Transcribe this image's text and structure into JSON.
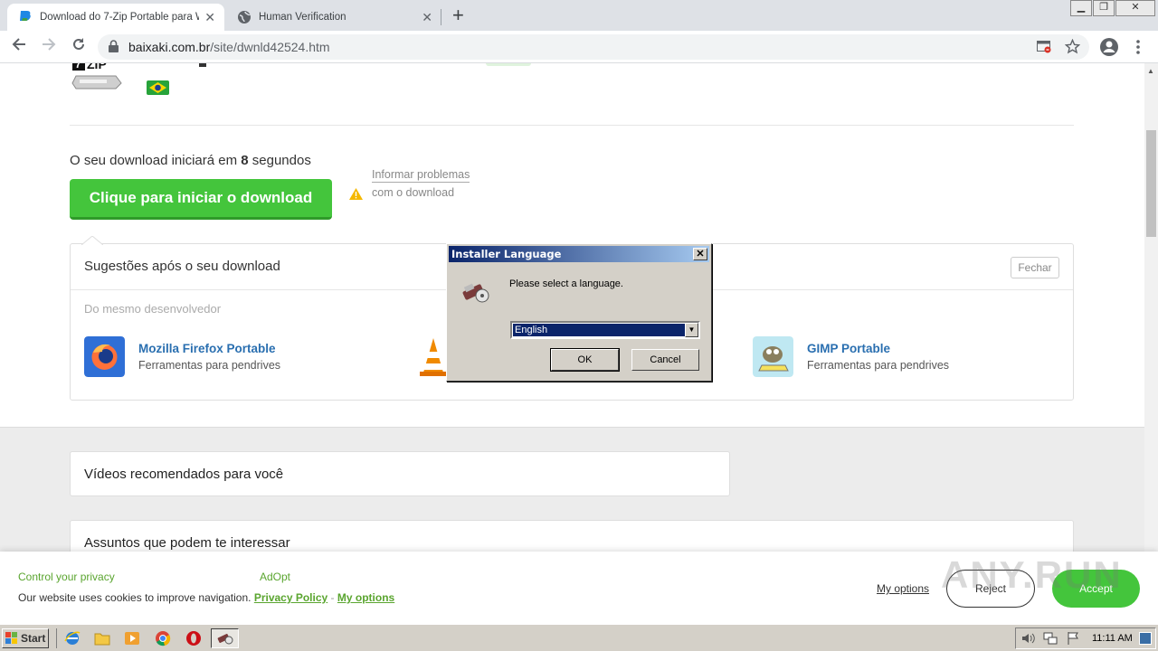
{
  "browser": {
    "tabs": [
      {
        "title": "Download do 7-Zip Portable para Windows",
        "active": true
      },
      {
        "title": "Human Verification",
        "active": false
      }
    ],
    "close_glyph": "✕",
    "new_tab_glyph": "+",
    "url_host": "baixaki.com.br",
    "url_path": "/site/dwnld42524.htm",
    "icons": [
      "back-icon",
      "forward-icon",
      "reload-icon",
      "lock-icon",
      "popup-blocked-icon",
      "bookmark-star-icon",
      "account-icon",
      "menu-icon"
    ]
  },
  "page": {
    "countdown_prefix": "O seu download iniciará em ",
    "countdown_seconds": "8",
    "countdown_suffix": " segundos",
    "download_button": "Clique para iniciar o download",
    "report_line1": "Informar problemas",
    "report_line2": "com o download",
    "suggestions": {
      "title": "Sugestões após o seu download",
      "close_button": "Fechar",
      "section_label": "Do mesmo desenvolvedor",
      "apps": [
        {
          "name": "Mozilla Firefox Portable",
          "category": "Ferramentas para pendrives"
        },
        {
          "name": "GIMP Portable",
          "category": "Ferramentas para pendrives"
        }
      ]
    },
    "videos_title": "Vídeos recomendados para você",
    "topics_title": "Assuntos que podem te interessar"
  },
  "cookie_bar": {
    "heading": "Control your privacy",
    "brand": "AdOpt",
    "message": "Our website uses cookies to improve navigation.",
    "privacy_link": "Privacy Policy",
    "separator": "-",
    "options_link": "My options",
    "my_options_button": "My options",
    "reject_button": "Reject",
    "accept_button": "Accept"
  },
  "watermark": "ANY.RUN",
  "dialog": {
    "title": "Installer Language",
    "prompt": "Please select a language.",
    "selected_language": "English",
    "ok_button": "OK",
    "cancel_button": "Cancel"
  },
  "taskbar": {
    "start_label": "Start",
    "clock": "11:11 AM"
  },
  "colors": {
    "download_green": "#44c53c",
    "link_blue": "#2a6fb0",
    "cookie_green": "#5aa52f",
    "win_title_start": "#0a246a"
  }
}
